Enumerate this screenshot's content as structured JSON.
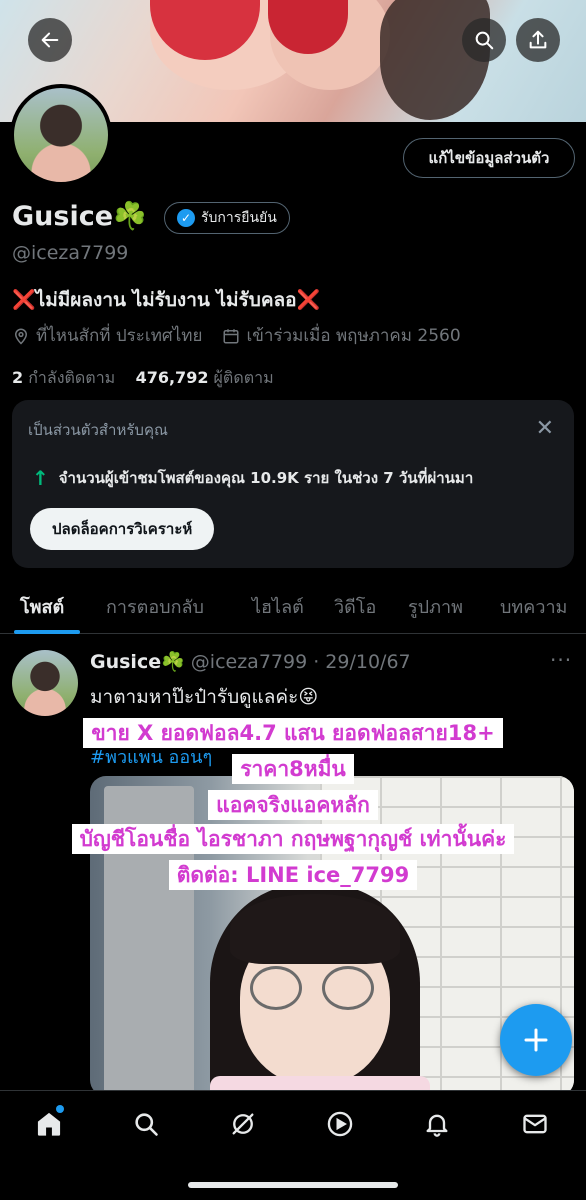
{
  "header": {
    "back_icon": "arrow-left-icon",
    "search_icon": "search-icon",
    "share_icon": "share-icon"
  },
  "profile": {
    "edit_button": "แก้ไขข้อมูลส่วนตัว",
    "display_name": "Gusice☘️",
    "verified_label": "รับการยืนยัน",
    "handle": "@iceza7799",
    "bio": "❌ไม่มีผลงาน ไม่รับงาน ไม่รับคลอ❌",
    "location": "ที่ไหนสักที่ ประเทศไทย",
    "joined": "เข้าร่วมเมื่อ พฤษภาคม 2560",
    "following_count": "2",
    "following_label": "กำลังติดตาม",
    "followers_count": "476,792",
    "followers_label": "ผู้ติดตาม"
  },
  "insight_card": {
    "title": "เป็นส่วนตัวสำหรับคุณ",
    "stat_text": "จำนวนผู้เข้าชมโพสต์ของคุณ 10.9K ราย ในช่วง 7 วันที่ผ่านมา",
    "button_label": "ปลดล็อคการวิเคราะห์"
  },
  "tabs": [
    {
      "label": "โพสต์"
    },
    {
      "label": "การตอบกลับ"
    },
    {
      "label": "ไฮไลต์"
    },
    {
      "label": "วิดีโอ"
    },
    {
      "label": "รูปภาพ"
    },
    {
      "label": "บทความ"
    }
  ],
  "post": {
    "name": "Gusice☘️",
    "handle_date": "@iceza7799 · 29/10/67",
    "more": "···",
    "text": "มาตามหาป๊ะป๋ารับดูแลค่ะ😝",
    "hashtag": "#พวแพน ออนๆ"
  },
  "overlay_text": [
    "ขาย X ยอดฟอล4.7 แสน ยอดฟอลสาย18+",
    "ราคา8หมื่น",
    "แอคจริงแอคหลัก",
    "บัญชีโอนชื่อ ไอรชาภา กฤษพฐากุญช์ เท่านั้นค่ะ",
    "ติดต่อ: LINE ice_7799"
  ],
  "fab_icon": "plus-icon",
  "bottom_nav": [
    "home-icon",
    "search-icon",
    "grok-icon",
    "video-icon",
    "notifications-icon",
    "messages-icon"
  ],
  "colors": {
    "accent": "#1d9bf0",
    "overlay_text": "#d23bd0",
    "growth_arrow": "#00ba7c"
  }
}
